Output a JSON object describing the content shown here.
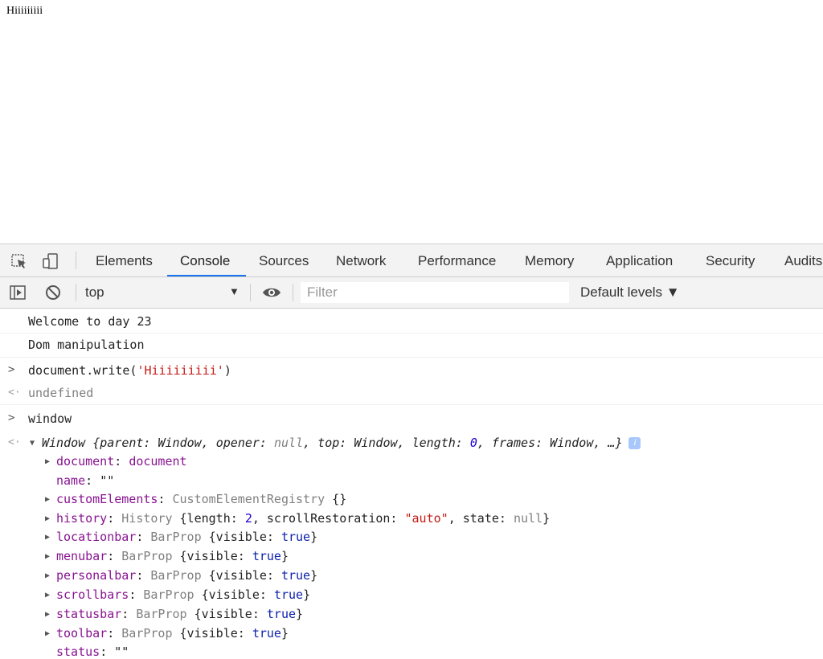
{
  "page": {
    "body_text": "Hiiiiiiiii"
  },
  "devtools": {
    "tabs": [
      {
        "label": "Elements"
      },
      {
        "label": "Console",
        "active": true
      },
      {
        "label": "Sources"
      },
      {
        "label": "Network"
      },
      {
        "label": "Performance"
      },
      {
        "label": "Memory"
      },
      {
        "label": "Application"
      },
      {
        "label": "Security"
      },
      {
        "label": "Audits"
      }
    ],
    "toolbar": {
      "context": "top",
      "filter_placeholder": "Filter",
      "levels_label": "Default levels ▼"
    },
    "colors": {
      "accent": "#1a73e8",
      "string": "#c41a16",
      "keyword": "#881391",
      "boolean": "#0d22aa",
      "number": "#1c00cf"
    },
    "console": {
      "logs": [
        "Welcome to day 23",
        "Dom manipulation"
      ],
      "input1": {
        "prefix": "document.write(",
        "arg": "'Hiiiiiiiii'",
        "suffix": ")"
      },
      "result1": "undefined",
      "input2": "window",
      "window_summary": {
        "head": "Window {parent: Window, opener: ",
        "null": "null",
        "mid": ", top: Window, length: ",
        "len": "0",
        "tail": ", frames: Window, …}",
        "badge": "i"
      },
      "props": {
        "document": {
          "key": "document",
          "value": "document"
        },
        "name": {
          "key": "name",
          "value": "\"\""
        },
        "customElements": {
          "key": "customElements",
          "cls": "CustomElementRegistry",
          "rest": " {}"
        },
        "history": {
          "key": "history",
          "cls": "History",
          "a": " {length: ",
          "len": "2",
          "b": ", scrollRestoration: ",
          "sr": "\"auto\"",
          "c": ", state: ",
          "state": "null",
          "d": "}"
        },
        "locationbar": {
          "key": "locationbar",
          "cls": "BarProp",
          "a": " {visible: ",
          "v": "true",
          "b": "}"
        },
        "menubar": {
          "key": "menubar",
          "cls": "BarProp",
          "a": " {visible: ",
          "v": "true",
          "b": "}"
        },
        "personalbar": {
          "key": "personalbar",
          "cls": "BarProp",
          "a": " {visible: ",
          "v": "true",
          "b": "}"
        },
        "scrollbars": {
          "key": "scrollbars",
          "cls": "BarProp",
          "a": " {visible: ",
          "v": "true",
          "b": "}"
        },
        "statusbar": {
          "key": "statusbar",
          "cls": "BarProp",
          "a": " {visible: ",
          "v": "true",
          "b": "}"
        },
        "toolbar": {
          "key": "toolbar",
          "cls": "BarProp",
          "a": " {visible: ",
          "v": "true",
          "b": "}"
        },
        "status": {
          "key": "status",
          "value": "\"\""
        }
      }
    }
  }
}
